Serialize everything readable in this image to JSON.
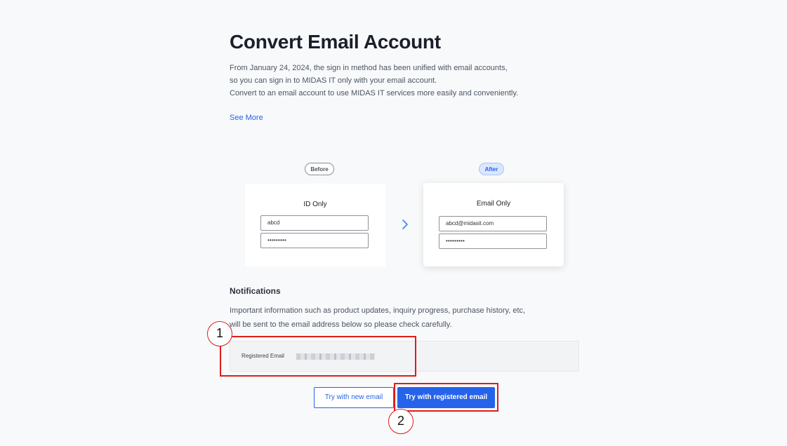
{
  "page": {
    "title": "Convert Email Account",
    "description_lines": [
      "From January 24, 2024, the sign in method has been unified with email accounts,",
      "so you can sign in to MIDAS IT only with your email account.",
      "Convert to an email account to use MIDAS IT services more easily and conveniently."
    ],
    "see_more": "See More"
  },
  "comparison": {
    "before": {
      "pill": "Before",
      "card_title": "ID Only",
      "id_value": "abcd",
      "password_value": "•••••••••"
    },
    "after": {
      "pill": "After",
      "card_title": "Email Only",
      "email_value": "abcd@midasit.com",
      "password_value": "•••••••••"
    },
    "arrow_icon": "chevron-right-icon"
  },
  "notifications": {
    "title": "Notifications",
    "description_lines": [
      "Important information such as product updates, inquiry progress, purchase history, etc,",
      "will be sent to the email address below so please check carefully."
    ],
    "registered_email_label": "Registered Email"
  },
  "actions": {
    "try_new_email": "Try with new email",
    "try_registered_email": "Try with registered email"
  },
  "annotations": {
    "badge_1": "1",
    "badge_2": "2"
  },
  "colors": {
    "accent": "#2563eb",
    "highlight": "#e01b1b",
    "background": "#f8f9fa"
  }
}
